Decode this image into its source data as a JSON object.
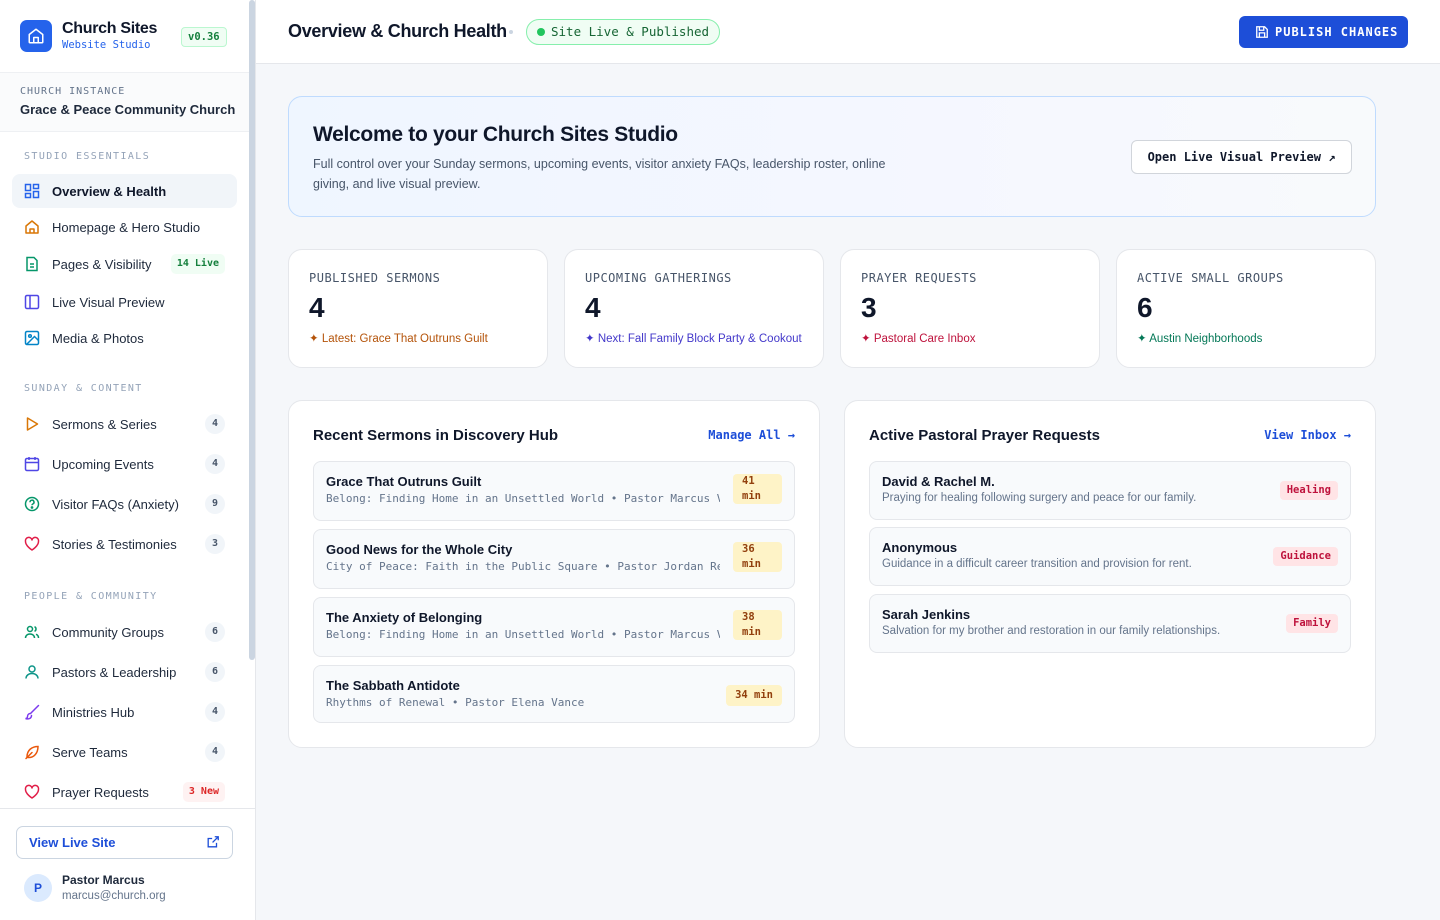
{
  "brand": {
    "title": "Church Sites",
    "subtitle": "Website Studio",
    "version": "v0.36"
  },
  "instance": {
    "label": "CHURCH INSTANCE",
    "name": "Grace & Peace Community Church"
  },
  "sidebar": {
    "sections": [
      "STUDIO ESSENTIALS",
      "SUNDAY & CONTENT",
      "PEOPLE & COMMUNITY"
    ],
    "items": [
      {
        "label": "Overview & Health",
        "icon": "dashboard-icon"
      },
      {
        "label": "Homepage & Hero Studio",
        "icon": "home-icon"
      },
      {
        "label": "Pages & Visibility",
        "icon": "page-icon",
        "count": "14 Live"
      },
      {
        "label": "Live Visual Preview",
        "icon": "layout-icon"
      },
      {
        "label": "Media & Photos",
        "icon": "image-icon"
      },
      {
        "label": "Sermons & Series",
        "icon": "play-icon",
        "count": "4"
      },
      {
        "label": "Upcoming Events",
        "icon": "calendar-icon",
        "count": "4"
      },
      {
        "label": "Visitor FAQs (Anxiety)",
        "icon": "help-circle-icon",
        "count": "9"
      },
      {
        "label": "Stories & Testimonies",
        "icon": "heart-icon",
        "count": "3"
      },
      {
        "label": "Community Groups",
        "icon": "users-icon",
        "count": "6"
      },
      {
        "label": "Pastors & Leadership",
        "icon": "user-icon",
        "count": "6"
      },
      {
        "label": "Ministries Hub",
        "icon": "brush-icon",
        "count": "4"
      },
      {
        "label": "Serve Teams",
        "icon": "leaf-icon",
        "count": "4"
      },
      {
        "label": "Prayer Requests",
        "icon": "heart-icon",
        "count": "3 New"
      }
    ],
    "view_live": "View Live Site",
    "user": {
      "initial": "P",
      "name": "Pastor Marcus",
      "email": "marcus@church.org"
    }
  },
  "header": {
    "title": "Overview & Church Health",
    "status": "Site Live & Published",
    "publish": "PUBLISH CHANGES"
  },
  "welcome": {
    "title": "Welcome to your Church Sites Studio",
    "desc": "Full control over your Sunday sermons, upcoming events, visitor anxiety FAQs, leadership roster, online giving, and live visual preview.",
    "button": "Open Live Visual Preview ↗"
  },
  "stats": [
    {
      "label": "PUBLISHED SERMONS",
      "value": "4",
      "note": "✦ Latest: Grace That Outruns Guilt",
      "color": "#b45309"
    },
    {
      "label": "UPCOMING GATHERINGS",
      "value": "4",
      "note": "✦ Next: Fall Family Block Party & Cookout",
      "color": "#4338ca"
    },
    {
      "label": "PRAYER REQUESTS",
      "value": "3",
      "note": "✦ Pastoral Care Inbox",
      "color": "#be123c"
    },
    {
      "label": "ACTIVE SMALL GROUPS",
      "value": "6",
      "note": "✦ Austin Neighborhoods",
      "color": "#047857"
    }
  ],
  "sermons": {
    "title": "Recent Sermons in Discovery Hub",
    "link": "Manage All →",
    "items": [
      {
        "title": "Grace That Outruns Guilt",
        "meta": "Belong: Finding Home in an Unsettled World • Pastor Marcus Vance",
        "duration": "41 min"
      },
      {
        "title": "Good News for the Whole City",
        "meta": "City of Peace: Faith in the Public Square • Pastor Jordan Reed",
        "duration": "36 min"
      },
      {
        "title": "The Anxiety of Belonging",
        "meta": "Belong: Finding Home in an Unsettled World • Pastor Marcus Vance",
        "duration": "38 min"
      },
      {
        "title": "The Sabbath Antidote",
        "meta": "Rhythms of Renewal • Pastor Elena Vance",
        "duration": "34 min"
      }
    ]
  },
  "prayers": {
    "title": "Active Pastoral Prayer Requests",
    "link": "View Inbox →",
    "items": [
      {
        "name": "David & Rachel M.",
        "desc": "Praying for healing following surgery and peace for our family.",
        "tag": "Healing"
      },
      {
        "name": "Anonymous",
        "desc": "Guidance in a difficult career transition and provision for rent.",
        "tag": "Guidance"
      },
      {
        "name": "Sarah Jenkins",
        "desc": "Salvation for my brother and restoration in our family relationships.",
        "tag": "Family"
      }
    ]
  }
}
